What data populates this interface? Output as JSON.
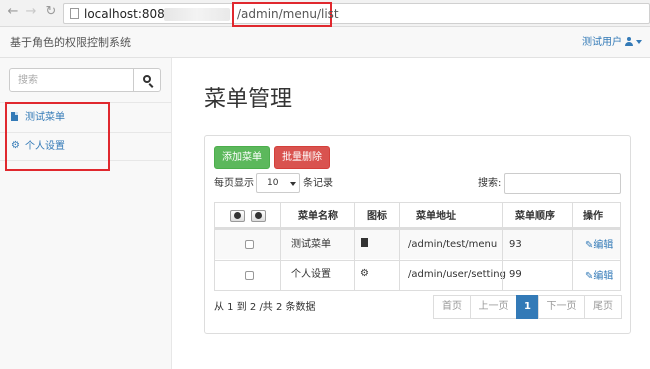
{
  "browser": {
    "url_host": "localhost:808C",
    "url_path": "/admin/menu/list",
    "back_icon": "arrow-left-icon",
    "forward_icon": "arrow-right-icon",
    "reload_icon": "reload-icon"
  },
  "navbar": {
    "brand": "基于角色的权限控制系统",
    "user": "测试用户"
  },
  "sidebar": {
    "search_placeholder": "搜索",
    "items": [
      {
        "label": "测试菜单",
        "icon": "file-icon"
      },
      {
        "label": "个人设置",
        "icon": "gear-icon"
      }
    ]
  },
  "main": {
    "title": "菜单管理",
    "add_button": "添加菜单",
    "bulk_delete_button": "批量删除",
    "length_label": "每页显示",
    "length_value": "10",
    "length_suffix": "条记录",
    "search_label": "搜索:",
    "table": {
      "columns": [
        "菜单名称",
        "图标",
        "菜单地址",
        "菜单顺序",
        "操作"
      ],
      "rows": [
        {
          "name": "测试菜单",
          "icon": "file-icon",
          "url": "/admin/test/menu",
          "order": "93",
          "action": "编辑"
        },
        {
          "name": "个人设置",
          "icon": "gear-icon",
          "url": "/admin/user/setting",
          "order": "99",
          "action": "编辑"
        }
      ]
    },
    "info": "从 1 到 2 /共 2 条数据",
    "pagination": [
      "首页",
      "上一页",
      "1",
      "下一页",
      "尾页"
    ]
  },
  "colors": {
    "link": "#337ab7",
    "success": "#5cb85c",
    "danger": "#d9534f",
    "annotation": "#e0282e"
  }
}
